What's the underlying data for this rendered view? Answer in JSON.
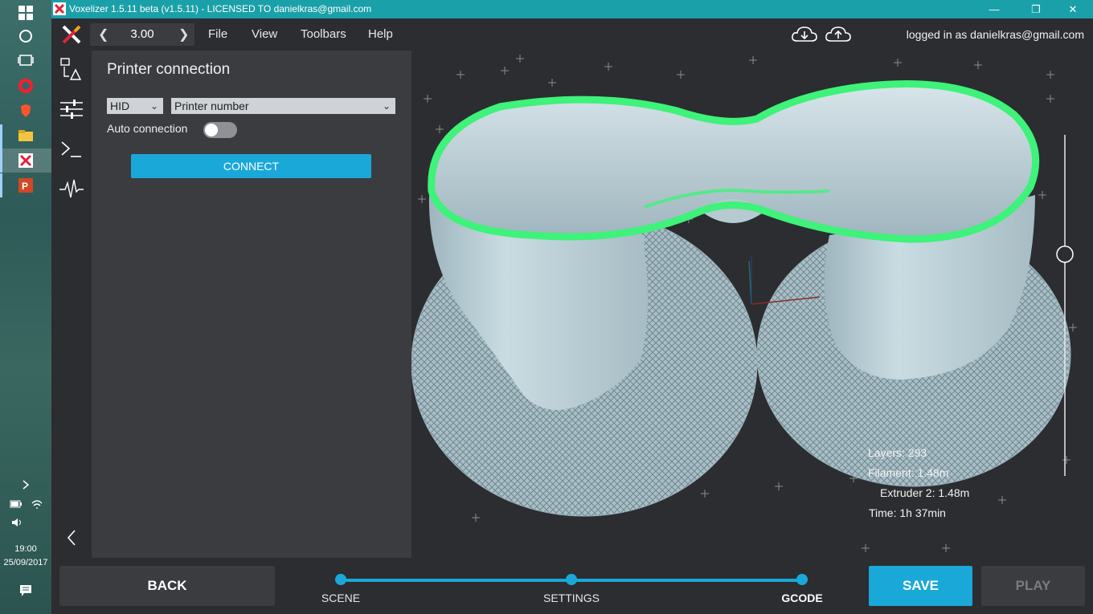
{
  "window": {
    "title": "Voxelizer 1.5.11 beta (v1.5.11) - LICENSED TO danielkras@gmail.com",
    "minimize": "—",
    "maximize": "❐",
    "close": "✕"
  },
  "taskbar": {
    "time": "19:00",
    "date": "25/09/2017",
    "apps": [
      "windows-start-icon",
      "cortana-icon",
      "task-view-icon",
      "opera-icon",
      "brave-icon",
      "file-explorer-icon",
      "voxelizer-icon",
      "powerpoint-icon"
    ]
  },
  "menubar": {
    "zoom_value": "3.00",
    "menus": [
      "File",
      "View",
      "Toolbars",
      "Help"
    ],
    "logged_in": "logged in as danielkras@gmail.com"
  },
  "panel": {
    "title": "Printer connection",
    "protocol": "HID",
    "printer_placeholder": "Printer number",
    "auto_connection_label": "Auto connection",
    "auto_connection_on": false,
    "connect_label": "CONNECT"
  },
  "viewport": {
    "stats": {
      "layers": "Layers: 293",
      "filament": "Filament: 1.48m",
      "extruder": "Extruder 2: 1.48m",
      "time": "Time: 1h 37min"
    },
    "layer_slider_fraction": 0.35
  },
  "bottom": {
    "back_label": "BACK",
    "save_label": "SAVE",
    "play_label": "PLAY",
    "steps": [
      "SCENE",
      "SETTINGS",
      "GCODE"
    ]
  },
  "colors": {
    "accent": "#1aa8d8",
    "titlebar": "#1aa0a8",
    "highlight_green": "#3ef27a",
    "model": "#b9ccd3"
  }
}
